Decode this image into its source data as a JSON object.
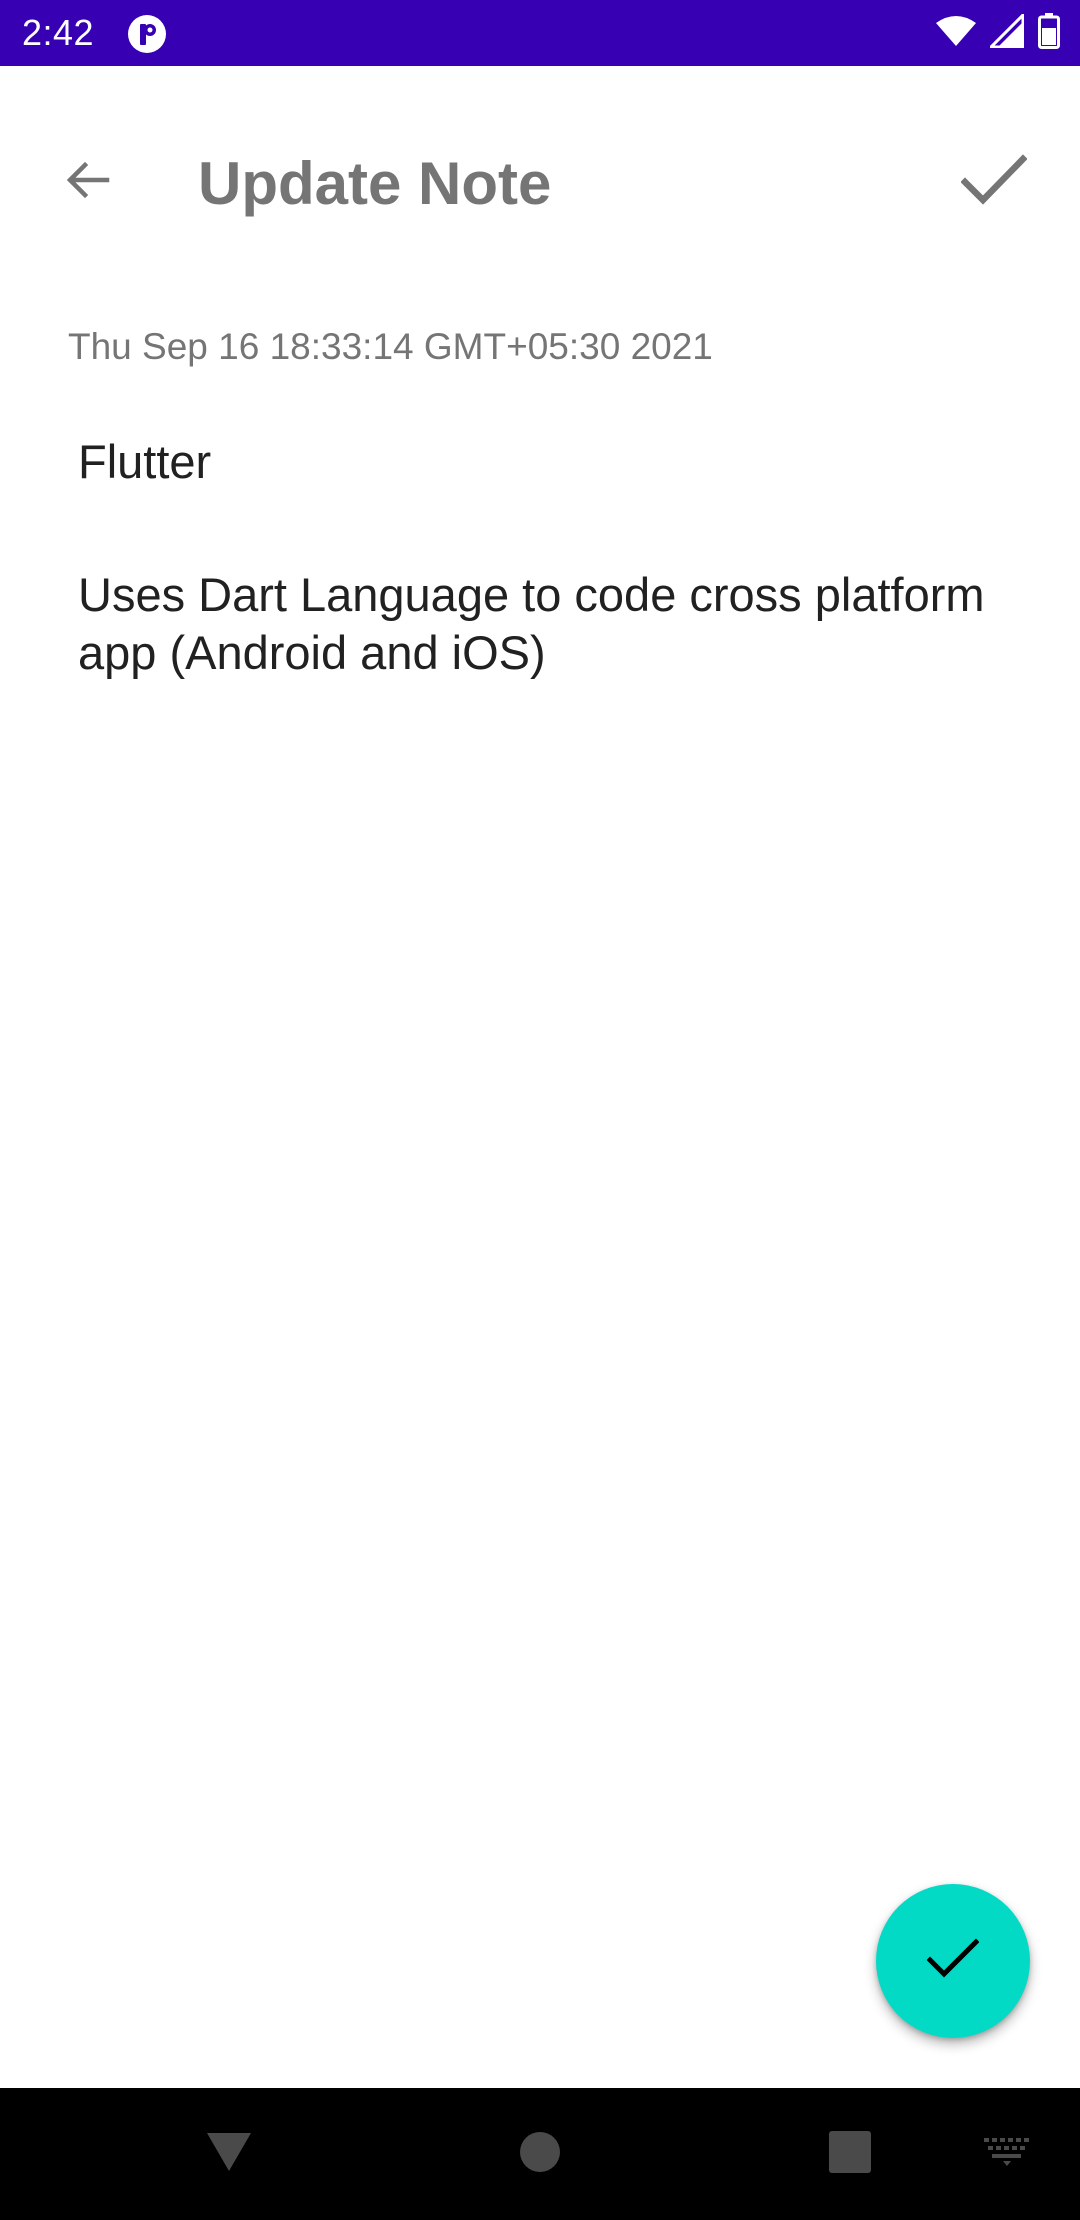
{
  "status_bar": {
    "time": "2:42",
    "app_icon": "notification-app-icon",
    "icons": [
      "wifi-icon",
      "cellular-signal-icon",
      "battery-icon"
    ],
    "background_color": "#3700b3"
  },
  "app_bar": {
    "title": "Update Note",
    "back_icon": "arrow-back-icon",
    "action_icon": "check-icon",
    "title_color": "#757575"
  },
  "note": {
    "date": "Thu Sep 16 18:33:14 GMT+05:30 2021",
    "title": "Flutter",
    "body": "Uses Dart Language to code cross platform app (Android and iOS)"
  },
  "fab": {
    "icon": "check-icon",
    "color": "#03dac5"
  },
  "nav_bar": {
    "buttons": [
      "back-triangle-icon",
      "home-circle-icon",
      "recents-square-icon",
      "keyboard-icon"
    ]
  }
}
